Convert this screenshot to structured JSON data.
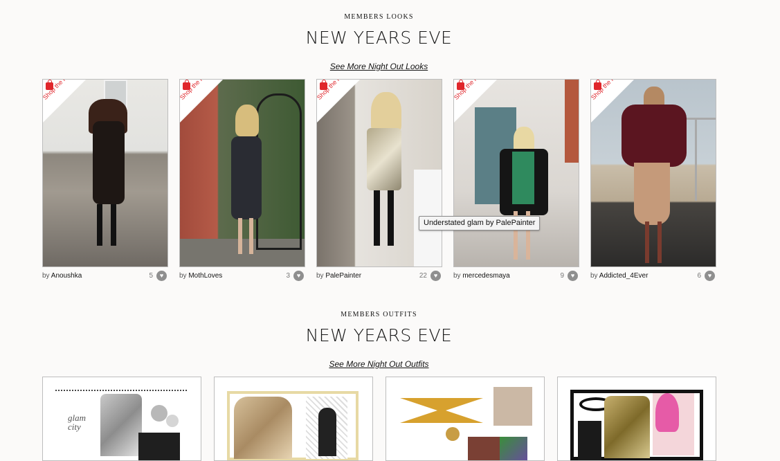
{
  "looks_section": {
    "kicker": "MEMBERS LOOKS",
    "title": "NEW YEARS EVE",
    "link": "See More Night Out Looks"
  },
  "shop_label": "Shop the look",
  "by_label": "by",
  "looks": [
    {
      "user": "Anoushka",
      "likes": "5"
    },
    {
      "user": "MothLoves",
      "likes": "3"
    },
    {
      "user": "PalePainter",
      "likes": "22"
    },
    {
      "user": "mercedesmaya",
      "likes": "9"
    },
    {
      "user": "Addicted_4Ever",
      "likes": "6"
    }
  ],
  "tooltip": "Understated glam by PalePainter",
  "outfits_section": {
    "kicker": "MEMBERS OUTFITS",
    "title": "NEW YEARS EVE",
    "link": "See More Night Out Outfits"
  },
  "outfit_cards": [
    {
      "text": "glam city"
    },
    {
      "text": ""
    },
    {
      "text": ""
    },
    {
      "text": ""
    }
  ],
  "colors": {
    "accent": "#e0262b",
    "background": "#fbfaf9",
    "border": "#bdbdbd"
  }
}
